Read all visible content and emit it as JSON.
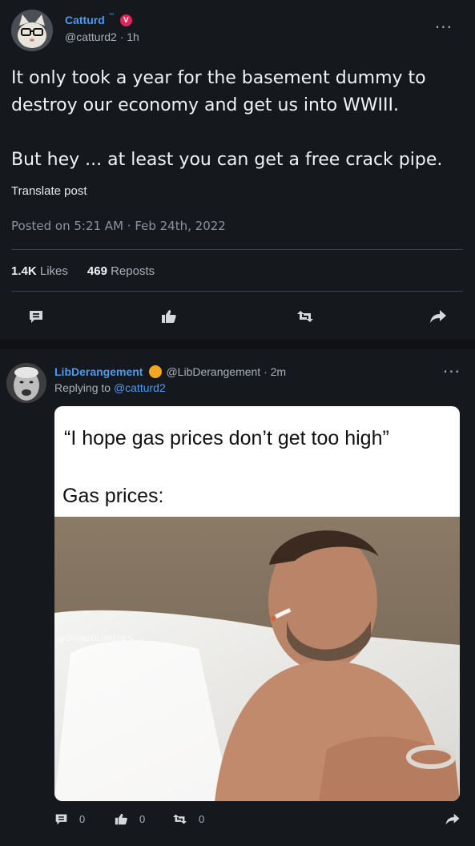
{
  "main_post": {
    "display_name": "Catturd",
    "tm": "™",
    "verified_badge": "V",
    "handle_time": "@catturd2 · 1h",
    "text": "It only took a year for the basement dummy to destroy our economy and get us into WWIII.\n\nBut hey ... at least you can get a free crack pipe.",
    "translate_label": "Translate post",
    "posted": "Posted on 5:21 AM · Feb 24th, 2022",
    "likes_count": "1.4K",
    "likes_label": "Likes",
    "reposts_count": "469",
    "reposts_label": "Reposts",
    "more": "···"
  },
  "reply": {
    "display_name": "LibDerangement",
    "handle_time": "@LibDerangement · 2m",
    "replying_prefix": "Replying to",
    "replying_to": "@catturd2",
    "more": "···",
    "meme_line1": "“I hope gas prices don’t get too high”",
    "meme_line2": "Gas prices:",
    "meme_watermark": "@GRANDOLDMEMES",
    "comments": "0",
    "likes": "0",
    "reposts": "0"
  },
  "colors": {
    "background": "#15181c",
    "link": "#4c9bf0",
    "muted": "#a8b0b8",
    "verified": "#e0245e",
    "badge_orange": "#f5a623"
  }
}
